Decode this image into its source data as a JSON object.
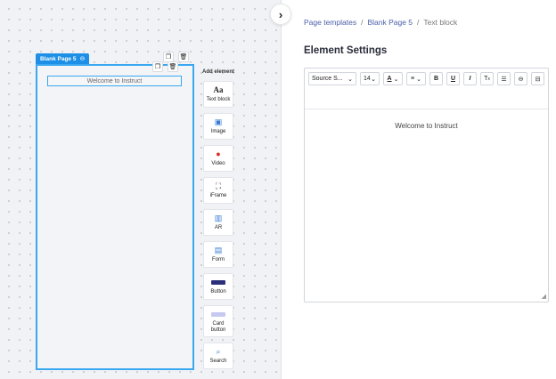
{
  "canvas": {
    "page_tab_label": "Blank Page 5",
    "page_tab_icon": "link-icon",
    "welcome_text": "Welcome to Instruct",
    "add_element_title": "Add element",
    "elements": [
      {
        "label": "Text block",
        "icon": "Aa"
      },
      {
        "label": "Image",
        "icon": "image-icon"
      },
      {
        "label": "Video",
        "icon": "video-icon"
      },
      {
        "label": "iFrame",
        "icon": "iframe-icon"
      },
      {
        "label": "AR",
        "icon": "ar-icon"
      },
      {
        "label": "Form",
        "icon": "form-icon"
      },
      {
        "label": "Button",
        "icon": "button-icon"
      },
      {
        "label": "Card button",
        "icon": "card-button-icon"
      },
      {
        "label": "Search",
        "icon": "search-icon"
      }
    ]
  },
  "breadcrumb": {
    "item1": "Page templates",
    "item2": "Blank Page 5",
    "item3": "Text block",
    "sep": "/"
  },
  "panel": {
    "title": "Element Settings",
    "font_family": "Source S...",
    "font_size": "14",
    "text_color_label": "A",
    "bold_label": "B",
    "underline_label": "U",
    "italic_label": "I",
    "tx_label": "T",
    "content": "Welcome to Instruct"
  },
  "colors": {
    "accent": "#1d8fe6",
    "selection": "#3aa8f0",
    "link": "#4a5fa8"
  }
}
